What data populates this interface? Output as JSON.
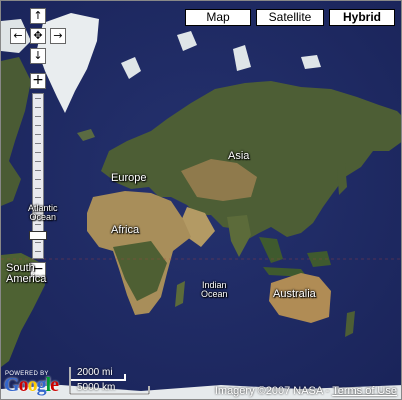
{
  "map_type_buttons": [
    {
      "label": "Map",
      "active": false
    },
    {
      "label": "Satellite",
      "active": false
    },
    {
      "label": "Hybrid",
      "active": true
    }
  ],
  "pan_controls": {
    "up": "↑",
    "down": "↓",
    "left": "←",
    "right": "→",
    "center": "✥"
  },
  "zoom": {
    "in": "+",
    "out": "−",
    "level_fraction": 0.9
  },
  "places": {
    "europe": "Europe",
    "asia": "Asia",
    "africa": "Africa",
    "australia": "Australia",
    "atlantic": "Atlantic\nOcean",
    "indian": "Indian\nOcean",
    "south_america": "South\nAmerica"
  },
  "scale_bar": {
    "miles": "2000 mi",
    "km": "5000 km"
  },
  "branding": {
    "powered_by": "POWERED BY",
    "logo_letters": [
      "G",
      "o",
      "o",
      "g",
      "l",
      "e"
    ],
    "logo_colors": [
      "#3366cc",
      "#cc0000",
      "#ffcc00",
      "#3366cc",
      "#009933",
      "#cc0000"
    ]
  },
  "attribution": {
    "imagery": "Imagery ©2007 NASA - ",
    "terms": "Terms of Use"
  },
  "colors": {
    "ocean": "#1f2a66",
    "land": "#4d5e35",
    "desert": "#a88e5a",
    "ice": "#e8ecef"
  }
}
